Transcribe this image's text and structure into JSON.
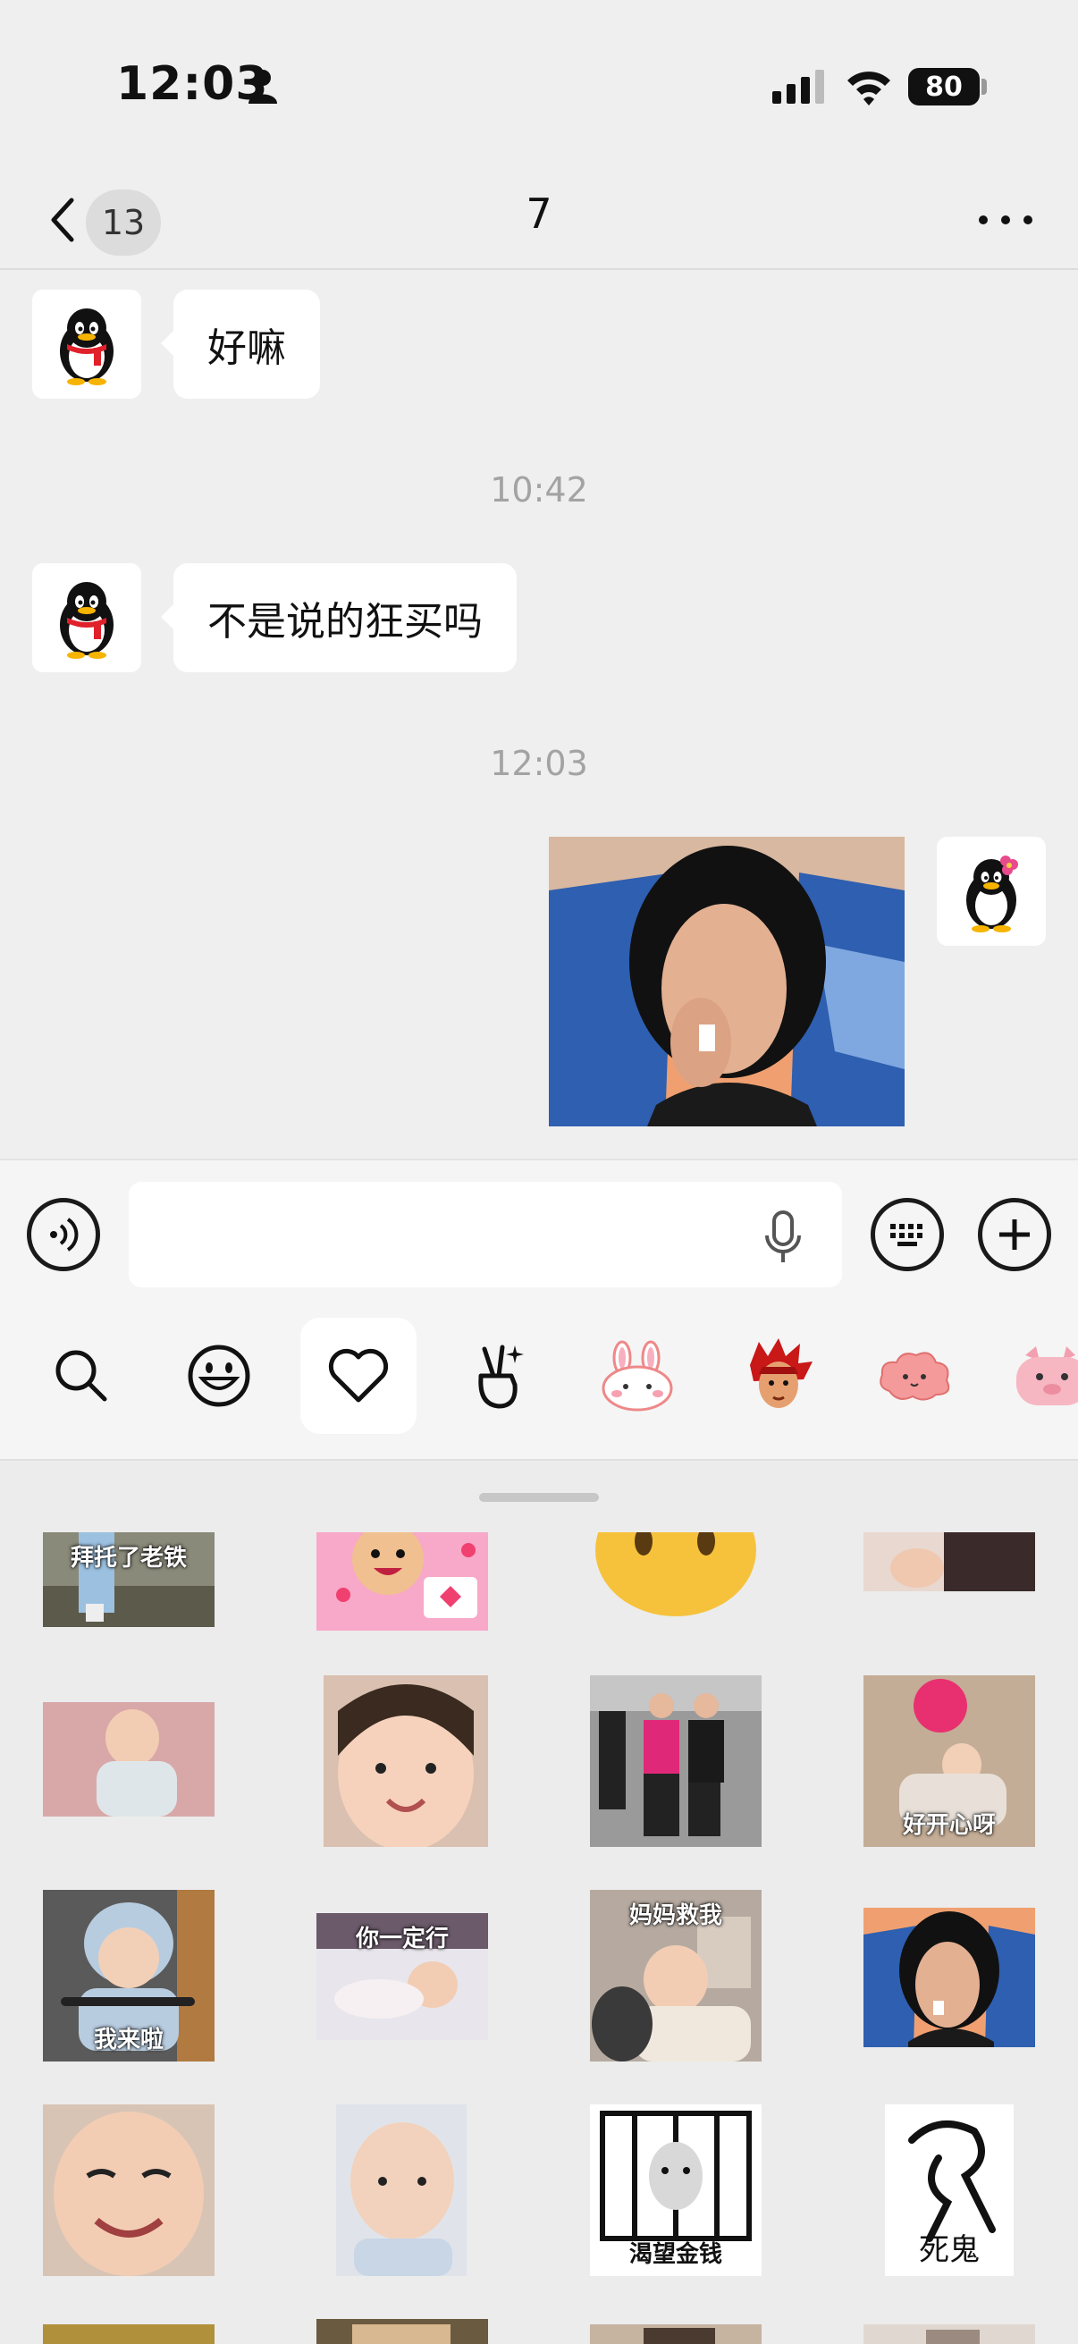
{
  "status_bar": {
    "time": "12:03",
    "battery": "80"
  },
  "nav": {
    "unread_count": "13",
    "title": "7"
  },
  "messages": [
    {
      "text": "好嘛"
    },
    {
      "timestamp": "10:42"
    },
    {
      "text": "不是说的狂买吗"
    },
    {
      "timestamp": "12:03"
    }
  ],
  "input": {
    "placeholder": ""
  },
  "emoji_tabs": [
    "search-icon",
    "smiley-icon",
    "heart-icon",
    "victory-hand-icon",
    "bunny-sticker-icon",
    "redhead-sticker-icon",
    "pink-cloud-sticker-icon",
    "pink-pig-sticker-icon"
  ],
  "stickers": {
    "row0": [
      "拜托了老铁",
      "",
      "",
      ""
    ],
    "row1": [
      "",
      "",
      "",
      "好开心呀"
    ],
    "row2": [
      "我来啦",
      "你一定行",
      "妈妈救我",
      ""
    ],
    "row3": [
      "",
      "",
      "渴望金钱",
      "死鬼"
    ]
  },
  "colors": {
    "background": "#efefef",
    "bubble": "#ffffff",
    "panel": "#ececec",
    "accent_red": "#e0202a"
  }
}
